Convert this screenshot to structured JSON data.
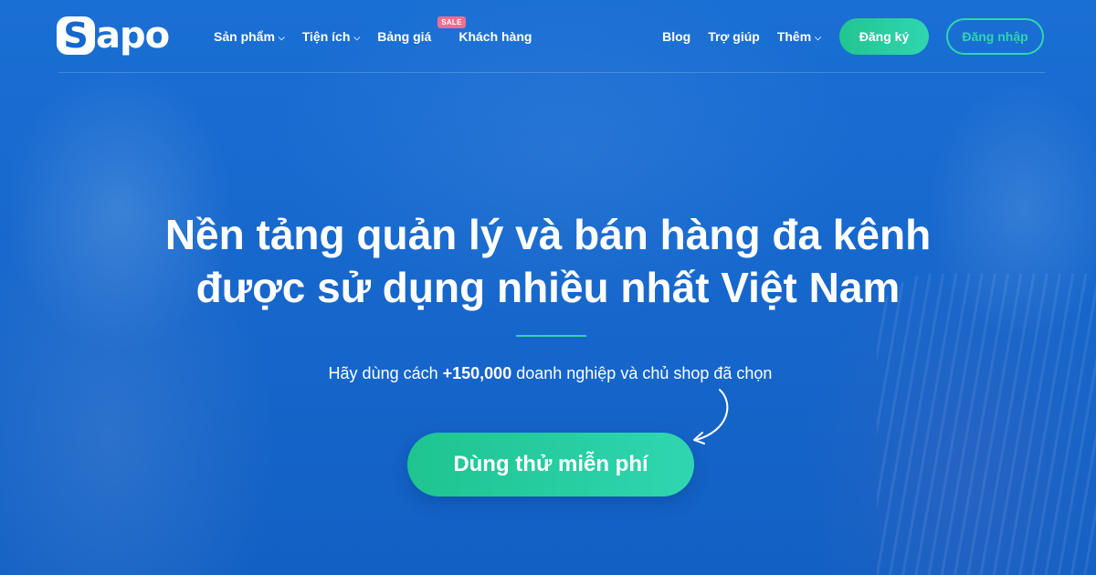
{
  "brand": {
    "logo_text": "Sapo",
    "logo_initial": "S",
    "logo_rest": "apo"
  },
  "nav_left": [
    {
      "label": "Sản phẩm",
      "dropdown": true
    },
    {
      "label": "Tiện ích",
      "dropdown": true
    },
    {
      "label": "Bảng giá",
      "badge": "SALE"
    },
    {
      "label": "Khách hàng"
    }
  ],
  "nav_right": [
    {
      "label": "Blog"
    },
    {
      "label": "Trợ giúp"
    },
    {
      "label": "Thêm",
      "dropdown": true
    }
  ],
  "buttons": {
    "register": "Đăng ký",
    "login": "Đăng nhập"
  },
  "hero": {
    "headline_line1": "Nền tảng quản lý và bán hàng đa kênh",
    "headline_line2": "được sử dụng nhiều nhất Việt Nam",
    "sub_prefix": "Hãy dùng cách ",
    "sub_count": "+150,000",
    "sub_suffix": " doanh nghiệp và chủ shop đã chọn",
    "cta": "Dùng thử miễn phí"
  },
  "colors": {
    "brand_blue": "#1667cc",
    "accent_green": "#2fd6b0",
    "sale_pink": "#f46d8e"
  },
  "icons": {
    "dropdown": "chevron-down-icon",
    "arrow": "curved-arrow-icon"
  }
}
